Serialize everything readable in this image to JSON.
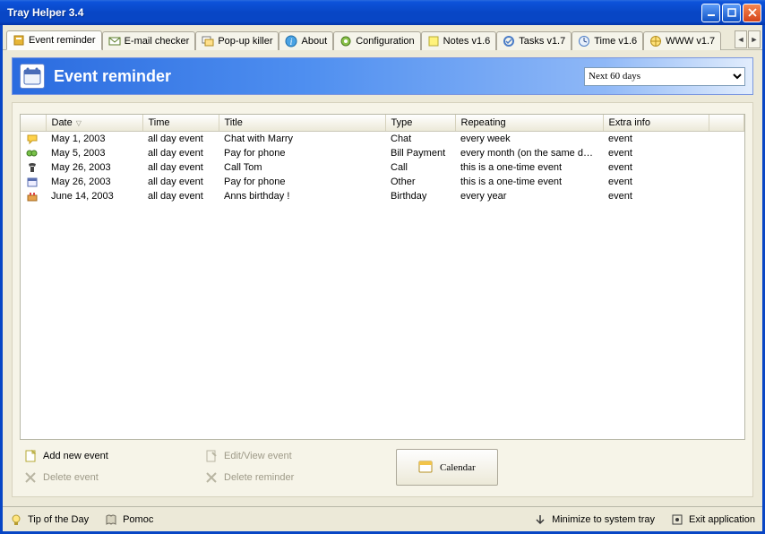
{
  "window": {
    "title": "Tray Helper  3.4"
  },
  "tabs": [
    {
      "label": "Event reminder",
      "icon": "bell"
    },
    {
      "label": "E-mail checker",
      "icon": "mail"
    },
    {
      "label": "Pop-up killer",
      "icon": "popup"
    },
    {
      "label": "About",
      "icon": "info"
    },
    {
      "label": "Configuration",
      "icon": "gear"
    },
    {
      "label": "Notes v1.6",
      "icon": "note"
    },
    {
      "label": "Tasks v1.7",
      "icon": "task"
    },
    {
      "label": "Time v1.6",
      "icon": "clock"
    },
    {
      "label": "WWW v1.7",
      "icon": "web"
    }
  ],
  "header": {
    "title": "Event reminder",
    "filter_selected": "Next 60 days"
  },
  "columns": [
    "",
    "Date",
    "Time",
    "Title",
    "Type",
    "Repeating",
    "Extra info"
  ],
  "sort_column": "Date",
  "events": [
    {
      "icon": "chat",
      "date": "May  1, 2003",
      "time": "all day event",
      "title": "Chat with Marry",
      "type": "Chat",
      "repeating": "every week",
      "extra": "event"
    },
    {
      "icon": "bill",
      "date": "May  5, 2003",
      "time": "all day event",
      "title": "Pay for phone",
      "type": "Bill Payment",
      "repeating": "every month (on the same date)",
      "extra": "event"
    },
    {
      "icon": "call",
      "date": "May 26, 2003",
      "time": "all day event",
      "title": "Call Tom",
      "type": "Call",
      "repeating": "this is a one-time event",
      "extra": "event"
    },
    {
      "icon": "other",
      "date": "May 26, 2003",
      "time": "all day event",
      "title": "Pay for phone",
      "type": "Other",
      "repeating": "this is a one-time event",
      "extra": "event"
    },
    {
      "icon": "bday",
      "date": "June 14, 2003",
      "time": "all day event",
      "title": "Anns birthday !",
      "type": "Birthday",
      "repeating": "every year",
      "extra": "event"
    }
  ],
  "actions": {
    "add": "Add new event",
    "delete": "Delete event",
    "edit": "Edit/View event",
    "delrem": "Delete reminder",
    "calendar": "Calendar"
  },
  "statusbar": {
    "tip": "Tip of the Day",
    "help": "Pomoc",
    "min": "Minimize to system tray",
    "exit": "Exit application"
  },
  "colors": {
    "titlebar": "#0846c5",
    "accent": "#2a6bdf",
    "panel": "#ece9d8"
  }
}
